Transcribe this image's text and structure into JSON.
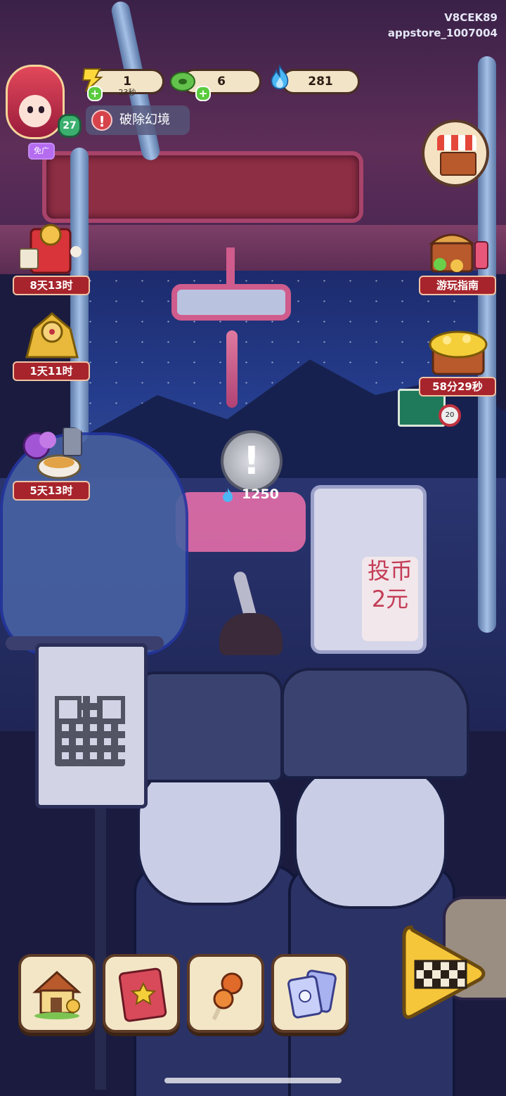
{
  "account": {
    "code": "V8CEK89",
    "channel": "appstore_1007004"
  },
  "player": {
    "level": "27",
    "ad_badge": "免广"
  },
  "resources": {
    "energy": {
      "value": "1",
      "timer": "23秒",
      "icon": "energy-icon",
      "color": "#ffd93b"
    },
    "jade": {
      "value": "6",
      "icon": "jade-coin-icon",
      "color": "#63c24c"
    },
    "flame": {
      "value": "281",
      "icon": "blue-flame-icon",
      "color": "#4bb8f5"
    }
  },
  "quest": {
    "label": "破除幻境",
    "icon": "alert-icon"
  },
  "shop": {
    "icon": "shop-stall-icon"
  },
  "events_left": [
    {
      "timer": "8天13时",
      "icon": "red-gift-box-icon"
    },
    {
      "timer": "1天11时",
      "icon": "golden-deity-icon"
    },
    {
      "timer": "5天13时",
      "icon": "flower-bowl-icon"
    }
  ],
  "events_right": [
    {
      "timer": "游玩指南",
      "icon": "treasure-chest-guide-icon"
    },
    {
      "timer": "58分29秒",
      "icon": "gold-treasure-icon"
    }
  ],
  "scene": {
    "hint_cost": "1250",
    "coin_box_text": "投币2元",
    "speed_sign": "20"
  },
  "dock": [
    {
      "icon": "home-icon"
    },
    {
      "icon": "book-icon"
    },
    {
      "icon": "meat-skewer-icon"
    },
    {
      "icon": "cards-icon"
    }
  ],
  "play": {
    "icon": "checkered-play-icon",
    "color": "#f5c63a"
  }
}
